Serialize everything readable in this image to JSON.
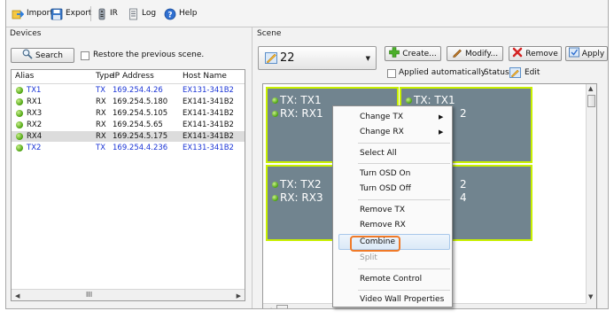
{
  "toolbar": {
    "import_label": "Import",
    "export_label": "Export",
    "ir_label": "IR",
    "log_label": "Log",
    "help_label": "Help"
  },
  "devices": {
    "title": "Devices",
    "search_label": "Search",
    "restore_label": "Restore the previous scene.",
    "columns": [
      "Alias",
      "Type",
      "IP Address",
      "Host Name"
    ],
    "rows": [
      {
        "alias": "TX1",
        "type": "TX",
        "ip": "169.254.4.26",
        "host": "EX131-341B2"
      },
      {
        "alias": "RX1",
        "type": "RX",
        "ip": "169.254.5.180",
        "host": "EX141-341B2"
      },
      {
        "alias": "RX3",
        "type": "RX",
        "ip": "169.254.5.105",
        "host": "EX141-341B2"
      },
      {
        "alias": "RX2",
        "type": "RX",
        "ip": "169.254.5.65",
        "host": "EX141-341B2"
      },
      {
        "alias": "RX4",
        "type": "RX",
        "ip": "169.254.5.175",
        "host": "EX141-341B2"
      },
      {
        "alias": "TX2",
        "type": "TX",
        "ip": "169.254.4.236",
        "host": "EX131-341B2"
      }
    ],
    "scroll_thumb": "III"
  },
  "scene": {
    "title": "Scene",
    "selected": "22",
    "create_label": "Create...",
    "modify_label": "Modify...",
    "remove_label": "Remove",
    "apply_label": "Apply",
    "applied_label": "Applied automatically",
    "status_label": "Status:",
    "edit_label": "Edit",
    "cells": [
      {
        "tx": "TX: TX1",
        "rx": "RX: RX1"
      },
      {
        "tx": "TX: TX1",
        "rx": "2"
      },
      {
        "tx": "TX: TX2",
        "rx": "RX: RX3"
      },
      {
        "tx": "2",
        "rx": "4"
      }
    ]
  },
  "context_menu": {
    "change_tx": "Change TX",
    "change_rx": "Change RX",
    "select_all": "Select All",
    "turn_osd_on": "Turn OSD On",
    "turn_osd_off": "Turn OSD Off",
    "remove_tx": "Remove TX",
    "remove_rx": "Remove RX",
    "combine": "Combine",
    "split": "Split",
    "remote_control": "Remote Control",
    "video_wall_properties": "Video Wall Properties"
  },
  "colors": {
    "accent_blue": "#1b35d6",
    "cell_bg": "#71848f",
    "cell_border": "#c9f000",
    "highlight_box": "#f07a28"
  }
}
